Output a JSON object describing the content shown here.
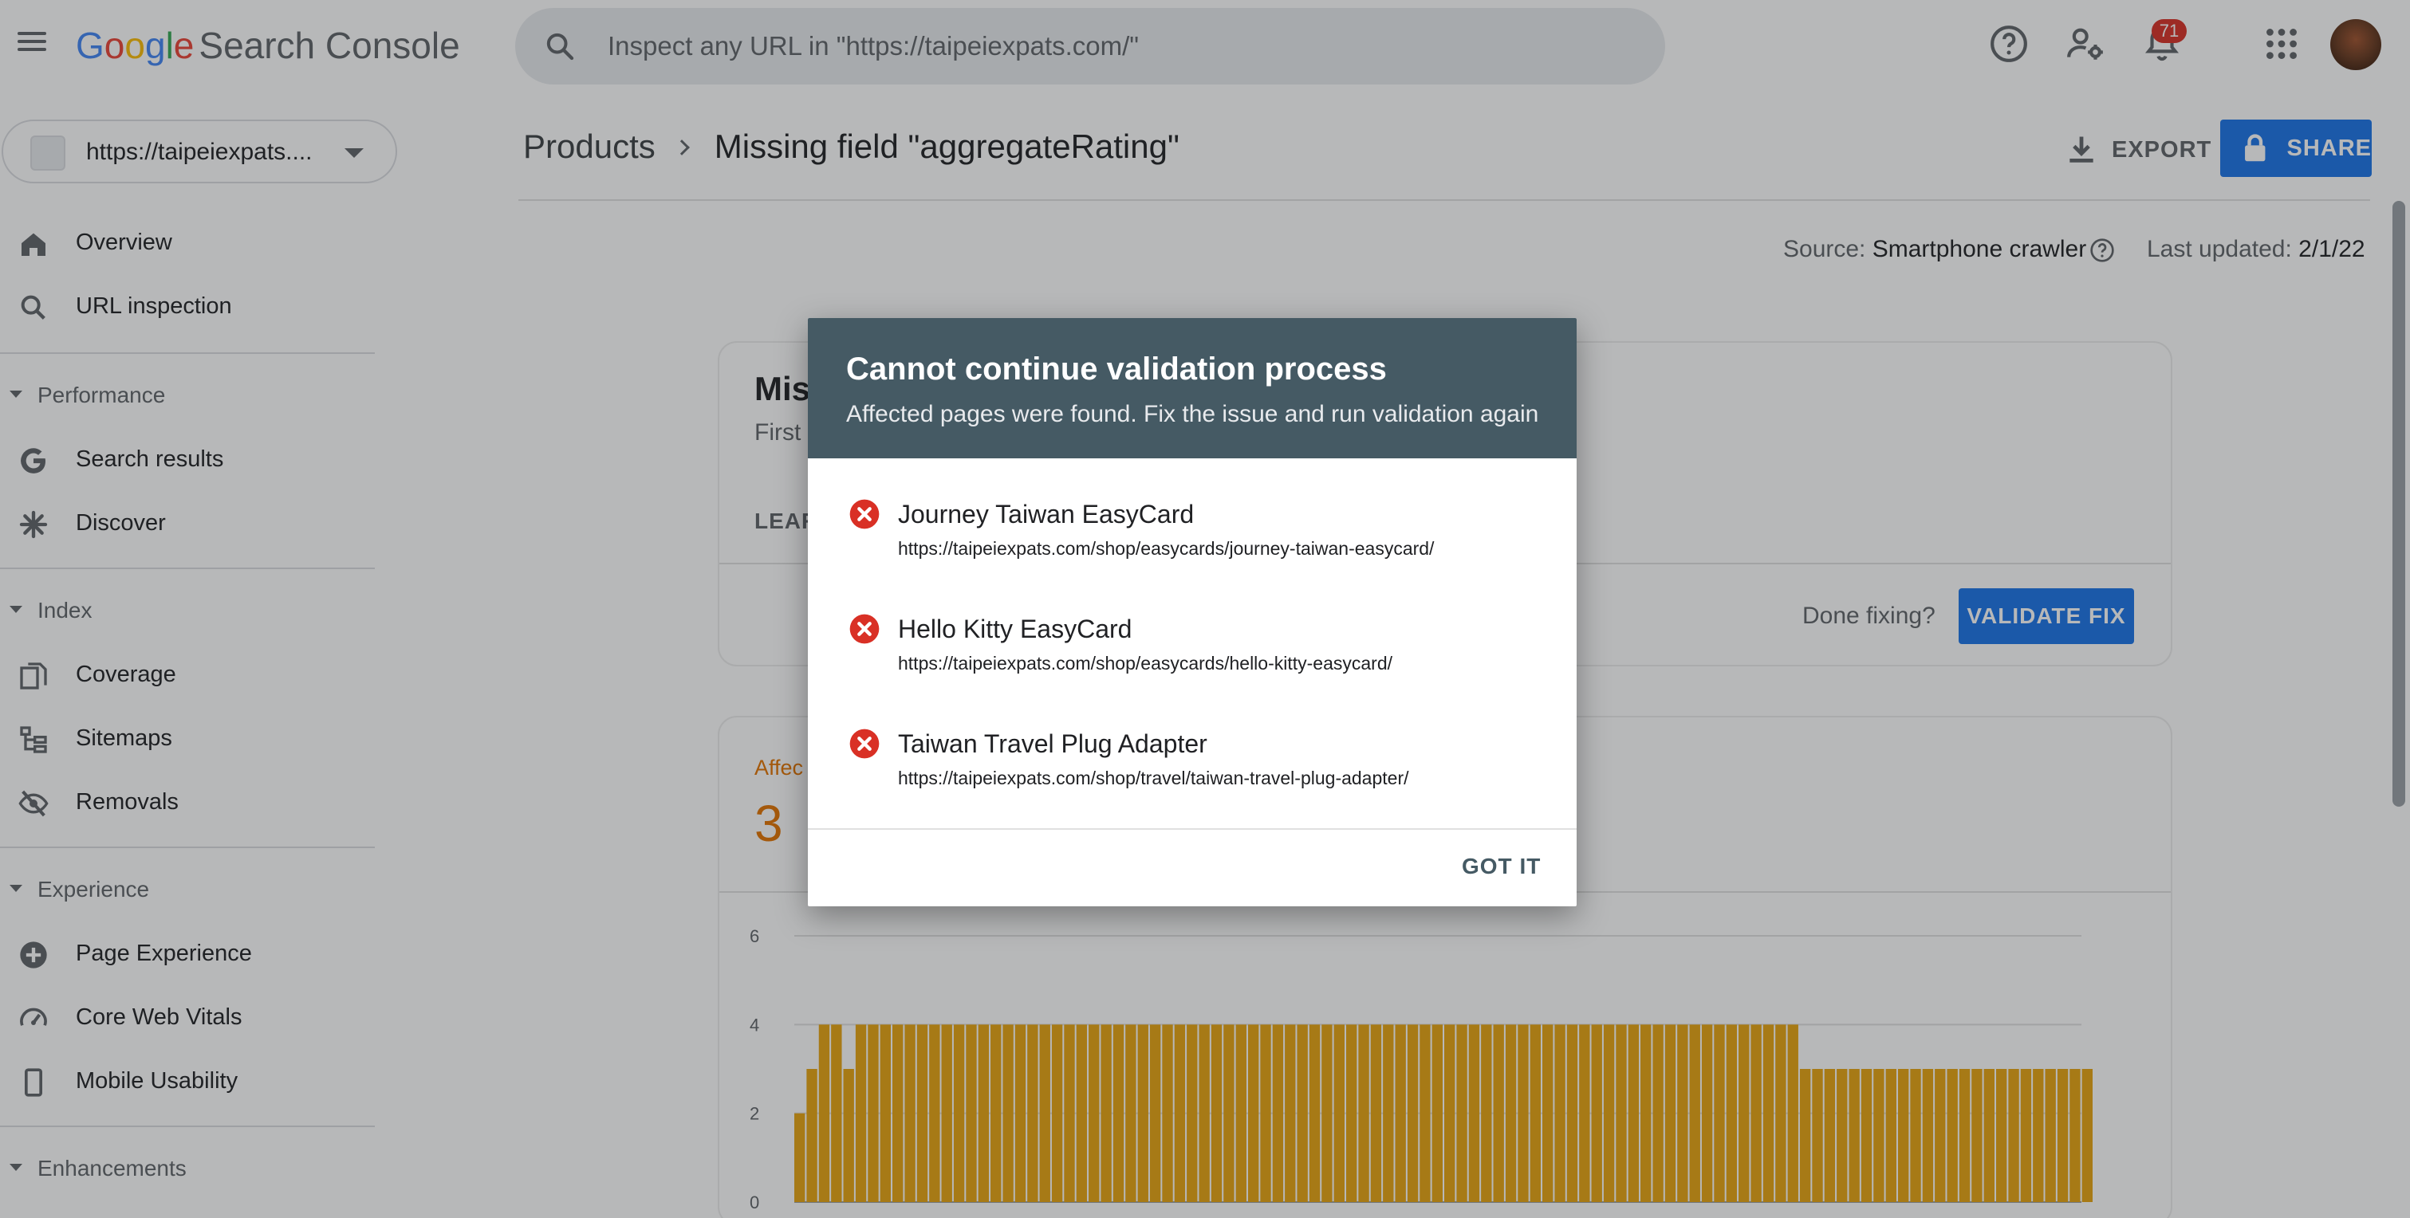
{
  "header": {
    "logo_google": [
      "G",
      "o",
      "o",
      "g",
      "l",
      "e"
    ],
    "logo_colors": [
      "#4285F4",
      "#EA4335",
      "#FBBC05",
      "#4285F4",
      "#34A853",
      "#EA4335"
    ],
    "product_name": "Search Console",
    "search_placeholder": "Inspect any URL in \"https://taipeiexpats.com/\"",
    "notification_count": "71"
  },
  "sidebar": {
    "property_url": "https://taipeiexpats....",
    "items_top": [
      {
        "label": "Overview",
        "icon": "home-icon"
      },
      {
        "label": "URL inspection",
        "icon": "search-icon"
      }
    ],
    "sections": [
      {
        "label": "Performance",
        "items": [
          {
            "label": "Search results",
            "icon": "google-g-icon"
          },
          {
            "label": "Discover",
            "icon": "asterisk-icon"
          }
        ]
      },
      {
        "label": "Index",
        "items": [
          {
            "label": "Coverage",
            "icon": "coverage-icon"
          },
          {
            "label": "Sitemaps",
            "icon": "sitemap-icon"
          },
          {
            "label": "Removals",
            "icon": "eye-off-icon"
          }
        ]
      },
      {
        "label": "Experience",
        "items": [
          {
            "label": "Page Experience",
            "icon": "plus-circle-icon"
          },
          {
            "label": "Core Web Vitals",
            "icon": "speedometer-icon"
          },
          {
            "label": "Mobile Usability",
            "icon": "phone-icon"
          }
        ]
      },
      {
        "label": "Enhancements",
        "items": []
      }
    ]
  },
  "main": {
    "breadcrumb_parent": "Products",
    "breadcrumb_current": "Missing field \"aggregateRating\"",
    "export_label": "EXPORT",
    "share_label": "SHARE",
    "source_label": "Source:",
    "source_value": "Smartphone crawler",
    "updated_label": "Last updated:",
    "updated_value": "2/1/22",
    "card_title": "Mis",
    "card_sub": "First",
    "learn_label": "LEAR",
    "done_fixing": "Done fixing?",
    "validate_label": "VALIDATE FIX",
    "affected_label": "Affec",
    "affected_count": "3"
  },
  "dialog": {
    "title": "Cannot continue validation process",
    "subtitle": "Affected pages were found. Fix the issue and run validation again",
    "items": [
      {
        "name": "Journey Taiwan EasyCard",
        "url": "https://taipeiexpats.com/shop/easycards/journey-taiwan-easycard/"
      },
      {
        "name": "Hello Kitty EasyCard",
        "url": "https://taipeiexpats.com/shop/easycards/hello-kitty-easycard/"
      },
      {
        "name": "Taiwan Travel Plug Adapter",
        "url": "https://taipeiexpats.com/shop/travel/taiwan-travel-plug-adapter/"
      }
    ],
    "confirm_label": "GOT IT"
  },
  "colors": {
    "accent": "#1a73e8",
    "bar": "#e8a40f",
    "affected": "#e37400",
    "dialog_header": "#455a64",
    "error": "#d93025"
  },
  "chart_data": {
    "type": "bar",
    "yticks": [
      "0",
      "2",
      "4",
      "6"
    ],
    "ylim": [
      0,
      6
    ],
    "values": [
      2,
      3,
      4,
      4,
      3,
      4,
      4,
      4,
      4,
      4,
      4,
      4,
      4,
      4,
      4,
      4,
      4,
      4,
      4,
      4,
      4,
      4,
      4,
      4,
      4,
      4,
      4,
      4,
      4,
      4,
      4,
      4,
      4,
      4,
      4,
      4,
      4,
      4,
      4,
      4,
      4,
      4,
      4,
      4,
      4,
      4,
      4,
      4,
      4,
      4,
      4,
      4,
      4,
      4,
      4,
      4,
      4,
      4,
      4,
      4,
      4,
      4,
      4,
      4,
      4,
      4,
      4,
      4,
      4,
      4,
      4,
      4,
      4,
      4,
      4,
      4,
      4,
      4,
      4,
      4,
      4,
      4,
      3,
      3,
      3,
      3,
      3,
      3,
      3,
      3,
      3,
      3,
      3,
      3,
      3,
      3,
      3,
      3,
      3,
      3,
      3,
      3,
      3,
      3,
      3,
      3
    ]
  }
}
